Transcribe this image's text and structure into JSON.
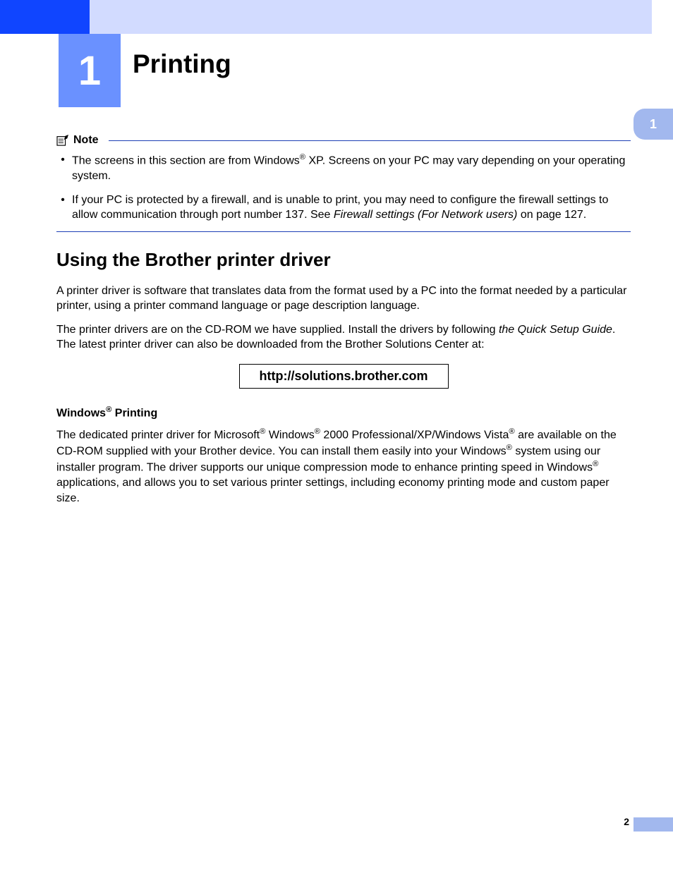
{
  "chapter": {
    "number": "1",
    "title": "Printing"
  },
  "sideTab": "1",
  "note": {
    "label": "Note",
    "bullets": [
      {
        "pre": "The screens in this section are from Windows",
        "sup1": "®",
        "post": " XP. Screens on your PC may vary depending on your operating system."
      },
      {
        "text": "If your PC is protected by a firewall, and is unable to print, you may need to configure the firewall settings to allow communication through port number 137. See ",
        "italic": "Firewall settings (For Network users)",
        "tail": " on page 127."
      }
    ]
  },
  "section": {
    "heading": "Using the Brother printer driver",
    "p1": "A printer driver is software that translates data from the format used by a PC into the format needed by a particular printer, using a printer command language or page description language.",
    "p2_pre": "The printer drivers are on the CD-ROM we have supplied. Install the drivers by following ",
    "p2_italic": "the Quick Setup Guide",
    "p2_post": ". The latest printer driver can also be downloaded from the Brother Solutions Center at:",
    "url": "http://solutions.brother.com",
    "sub_pre": "Windows",
    "sub_sup": "®",
    "sub_post": " Printing",
    "p3_a": "The dedicated printer driver for Microsoft",
    "p3_s1": "®",
    "p3_b": " Windows",
    "p3_s2": "®",
    "p3_c": " 2000 Professional/XP/Windows Vista",
    "p3_s3": "®",
    "p3_d": " are available on the CD-ROM supplied with your Brother device. You can install them easily into your Windows",
    "p3_s4": "®",
    "p3_e": " system using our installer program. The driver supports our unique compression mode to enhance printing speed in Windows",
    "p3_s5": "®",
    "p3_f": " applications, and allows you to set various printer settings, including economy printing mode and custom paper size."
  },
  "pageNumber": "2"
}
